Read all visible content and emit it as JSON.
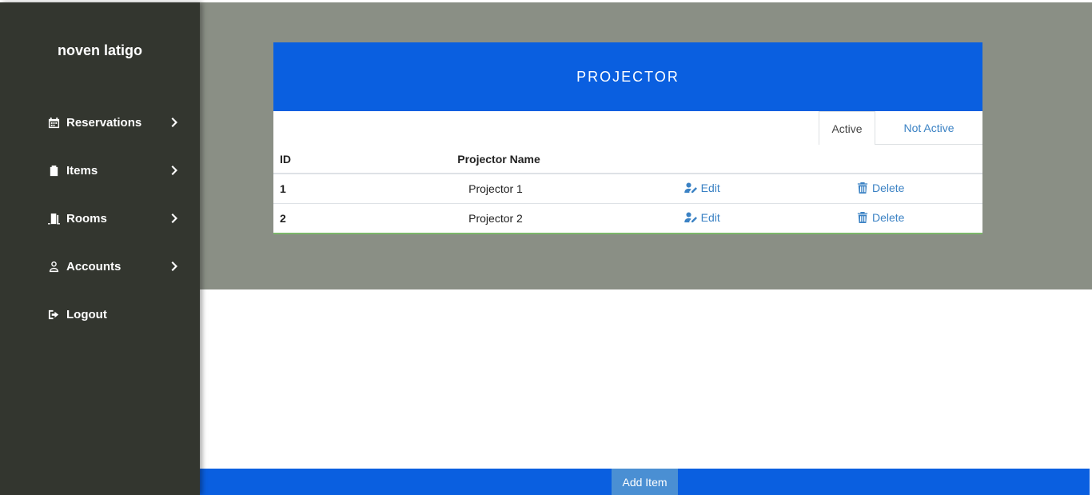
{
  "sidebar": {
    "brand": "noven latigo",
    "items": [
      {
        "label": "Reservations",
        "icon": "calendar-icon"
      },
      {
        "label": "Items",
        "icon": "clipboard-icon"
      },
      {
        "label": "Rooms",
        "icon": "door-icon"
      },
      {
        "label": "Accounts",
        "icon": "user-icon"
      },
      {
        "label": "Logout",
        "icon": "logout-icon"
      }
    ]
  },
  "card": {
    "title": "PROJECTOR",
    "tabs": {
      "active": "Active",
      "inactive": "Not Active"
    },
    "columns": {
      "id": "ID",
      "name": "Projector Name"
    },
    "rows": [
      {
        "id": "1",
        "name": "Projector 1",
        "edit": "Edit",
        "delete": "Delete"
      },
      {
        "id": "2",
        "name": "Projector 2",
        "edit": "Edit",
        "delete": "Delete"
      }
    ]
  },
  "footer": {
    "add_label": "Add Item"
  },
  "colors": {
    "sidebar": "#33362f",
    "header": "#0a5fe0",
    "panel": "#8a8f85",
    "link": "#3b82c4"
  }
}
